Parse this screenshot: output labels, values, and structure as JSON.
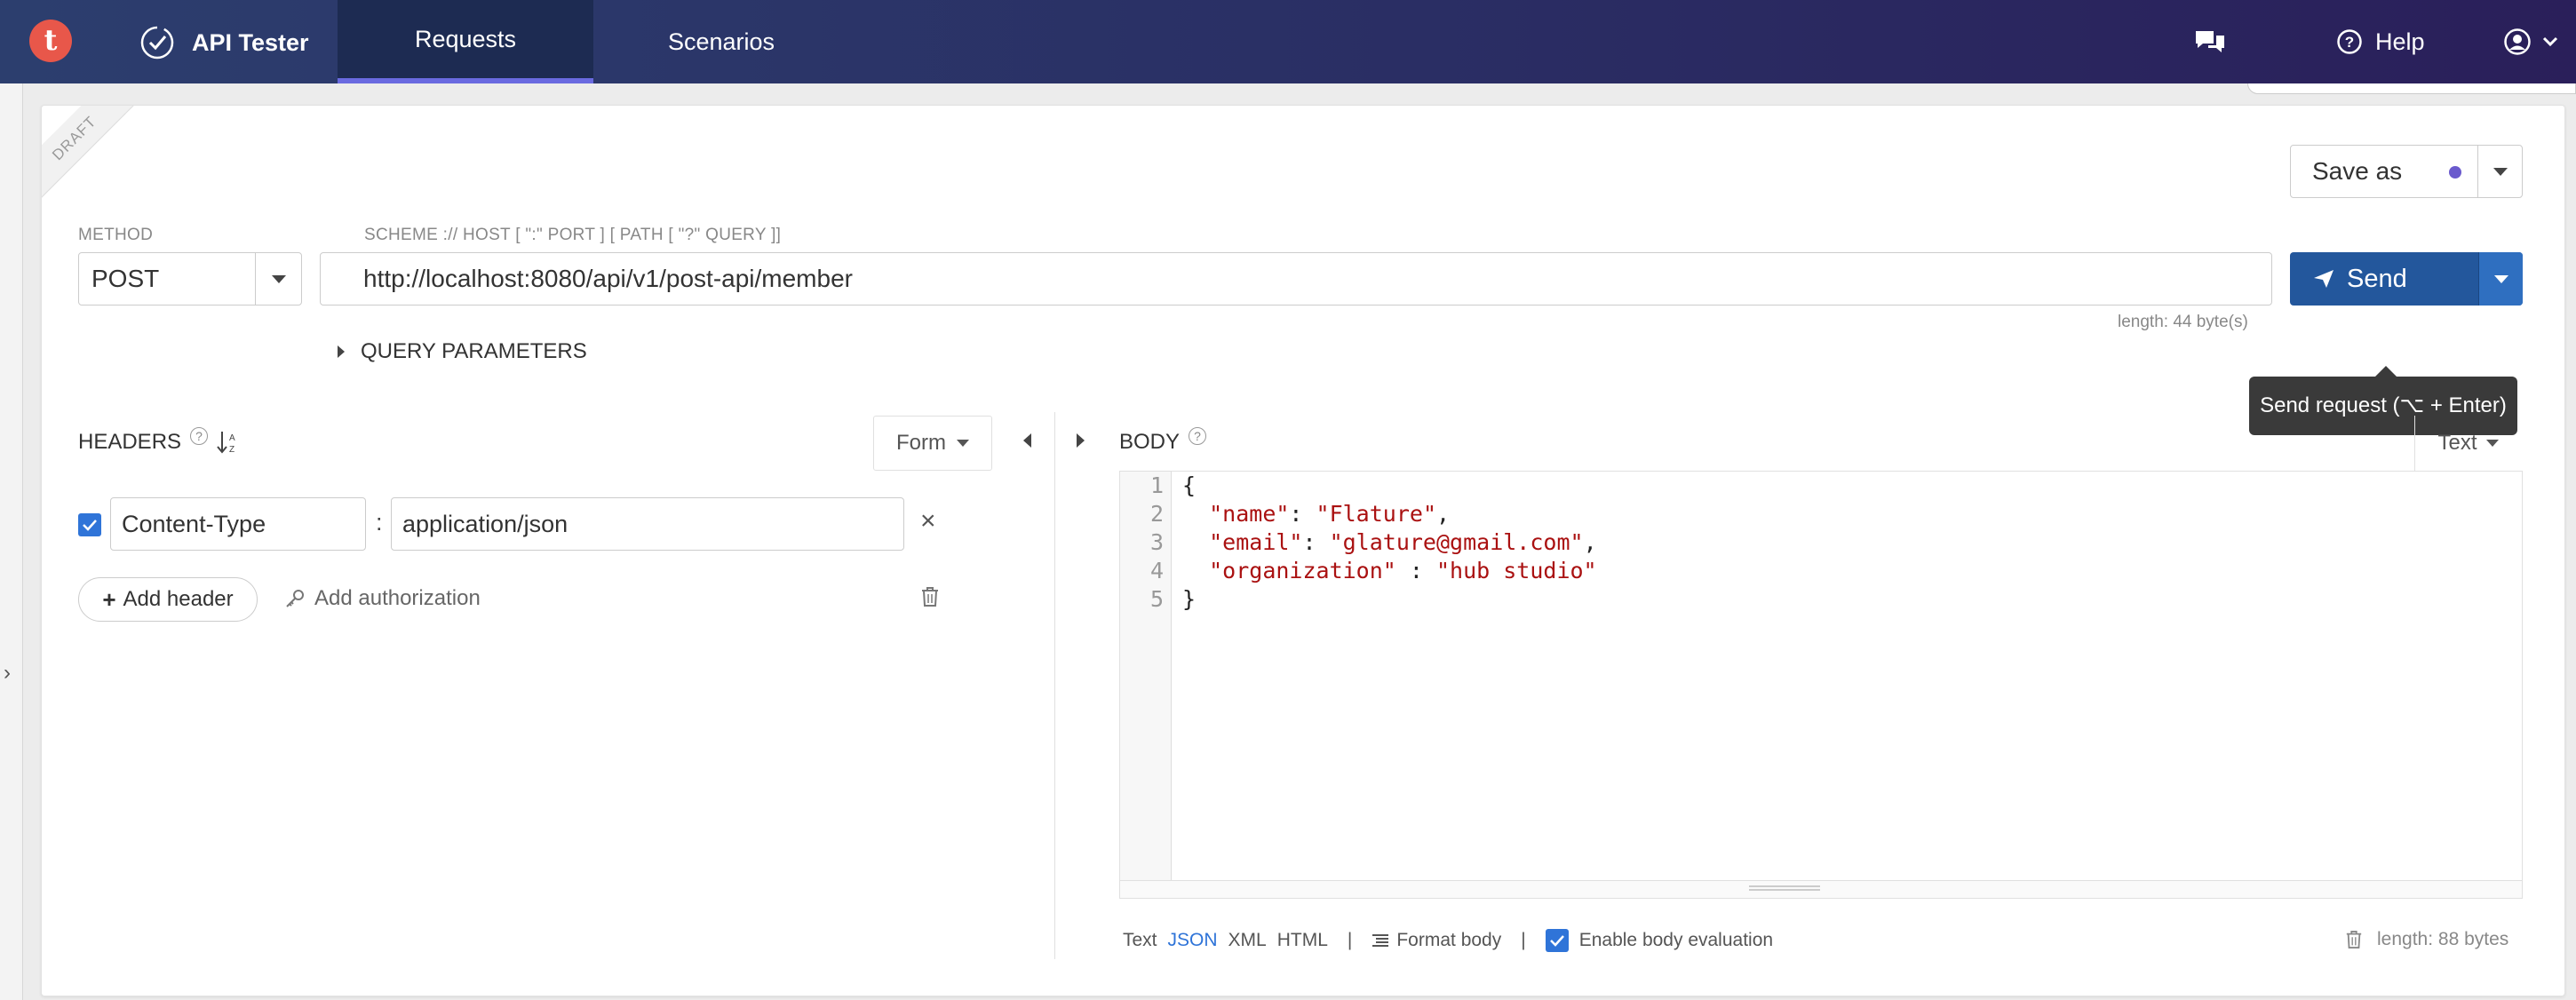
{
  "nav": {
    "logo_letter": "t",
    "app_name": "API Tester",
    "tabs": [
      "Requests",
      "Scenarios"
    ],
    "help_label": "Help"
  },
  "draft_label": "DRAFT",
  "request": {
    "method_label": "METHOD",
    "method": "POST",
    "url_label": "SCHEME :// HOST [ \":\" PORT ] [ PATH [ \"?\" QUERY ]]",
    "url": "http://localhost:8080/api/v1/post-api/member",
    "url_length": "length: 44 byte(s)",
    "save_as_label": "Save as",
    "send_label": "Send",
    "send_tooltip": "Send request (⌥ + Enter)",
    "query_params_label": "QUERY PARAMETERS"
  },
  "headers": {
    "title": "HEADERS",
    "form_label": "Form",
    "rows": [
      {
        "enabled": true,
        "key": "Content-Type",
        "value": "application/json"
      }
    ],
    "add_header_label": "Add header",
    "add_auth_label": "Add authorization"
  },
  "body": {
    "title": "BODY",
    "text_label": "Text",
    "line_numbers": [
      "1",
      "2",
      "3",
      "4",
      "5"
    ],
    "code": {
      "l1": "{",
      "l2_key": "\"name\"",
      "l2_rest": ": ",
      "l2_val": "\"Flature\"",
      "l2_end": ",",
      "l3_key": "\"email\"",
      "l3_rest": ": ",
      "l3_val": "\"glature@gmail.com\"",
      "l3_end": ",",
      "l4_key": "\"organization\"",
      "l4_rest": " : ",
      "l4_val": "\"hub studio\"",
      "l5": "}"
    },
    "formats": [
      "Text",
      "JSON",
      "XML",
      "HTML"
    ],
    "active_format": "JSON",
    "format_body_label": "Format body",
    "enable_eval_label": "Enable body evaluation",
    "length": "length: 88 bytes"
  },
  "colors": {
    "accent": "#2f74d8",
    "send": "#23579c",
    "logo": "#e8574a"
  }
}
